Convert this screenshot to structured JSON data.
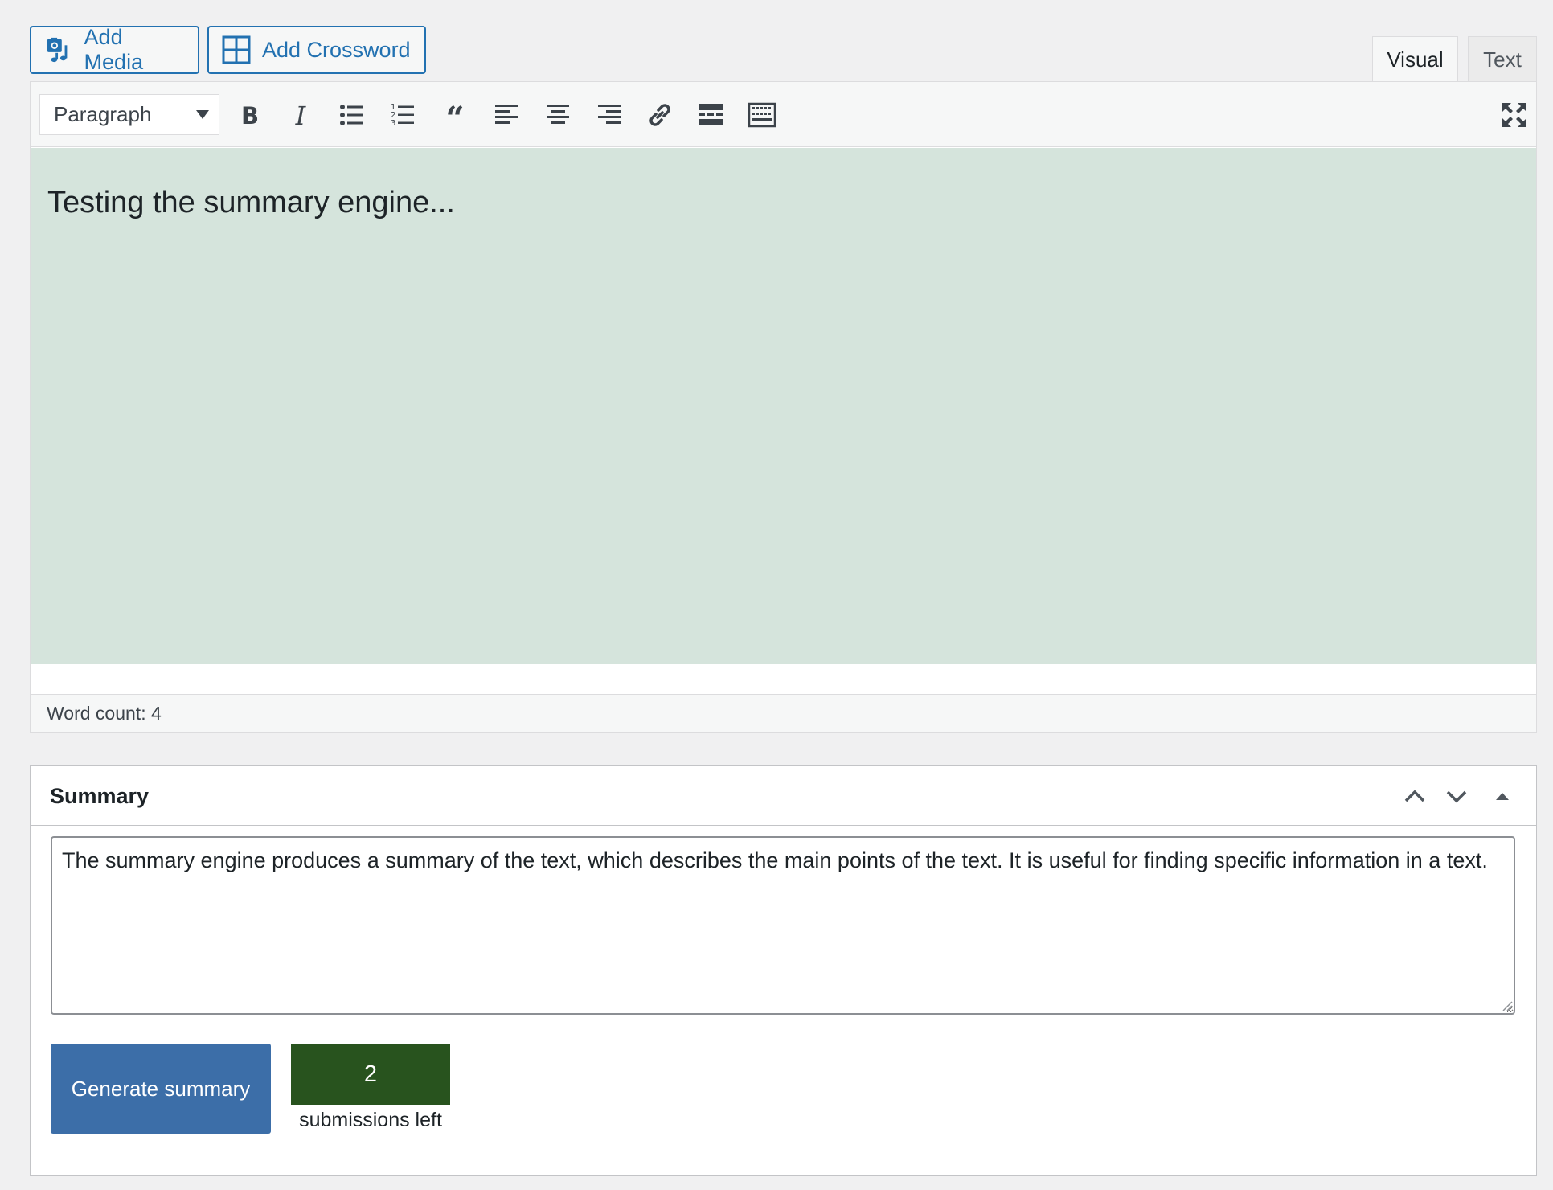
{
  "media_buttons": {
    "add_media_label": "Add Media",
    "add_crossword_label": "Add Crossword"
  },
  "editor_tabs": {
    "visual_label": "Visual",
    "text_label": "Text",
    "active": "Visual"
  },
  "toolbar": {
    "format_select_value": "Paragraph",
    "buttons": [
      "bold-icon",
      "italic-icon",
      "bulleted-list-icon",
      "numbered-list-icon",
      "blockquote-icon",
      "align-left-icon",
      "align-center-icon",
      "align-right-icon",
      "link-icon",
      "read-more-icon",
      "toolbar-toggle-icon",
      "fullscreen-icon"
    ]
  },
  "editor": {
    "content": "Testing the summary engine...",
    "word_count_label": "Word count: 4"
  },
  "summary_box": {
    "title": "Summary",
    "text": "The summary engine produces a summary of the text, which describes the main points of the text. It is useful for finding specific information in a text.",
    "generate_button_label": "Generate summary",
    "submissions_count": "2",
    "submissions_label": "submissions left"
  },
  "colors": {
    "accent": "#2271b1",
    "editor_background": "#d5e4dc",
    "generate_button": "#3c6ea8",
    "counter_background": "#28531e"
  }
}
